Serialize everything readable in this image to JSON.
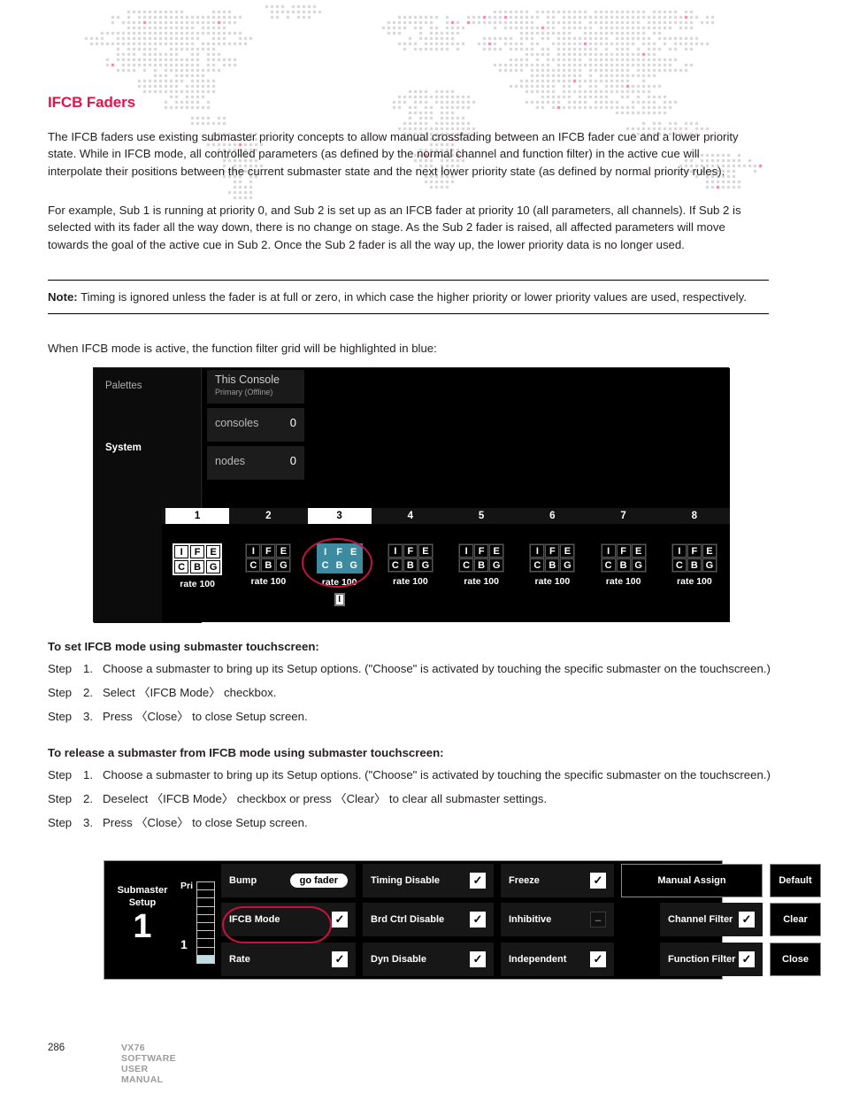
{
  "section": {
    "title": "IFCB Faders",
    "title_color": "#e2144a",
    "paragraphs": [
      "The IFCB faders use existing submaster priority concepts to allow manual crossfading between an IFCB fader cue and a lower priority state. While in IFCB mode, all controlled parameters (as defined by the normal channel and function filter) in the active cue will interpolate their positions between the current submaster state and the next lower priority state (as defined by normal priority rules).",
      "For example, Sub 1 is running at priority 0, and Sub 2 is set up as an IFCB fader at priority 10 (all parameters, all channels). If Sub 2 is selected with its fader all the way down, there is no change on stage. As the Sub 2 fader is raised, all affected parameters will move towards the goal of the active cue in Sub 2. Once the Sub 2 fader is all the way up, the lower priority data is no longer used."
    ],
    "note_label": "Note:",
    "note_text": " Timing is ignored unless the fader is at full or zero, in which case the higher priority or lower priority values are used, respectively.",
    "caption": "When IFCB mode is active, the function filter grid will be highlighted in blue:"
  },
  "fader_shot": {
    "sidebar": {
      "palettes_label": "Palettes",
      "system_label": "System"
    },
    "tiles": {
      "console_name": "This Console",
      "console_state": "Primary (Offline)",
      "consoles_key": "consoles",
      "consoles_value": "0",
      "nodes_key": "nodes",
      "nodes_value": "0"
    },
    "highlight_color": "#3d8ba1",
    "annotation_color": "#c8103f",
    "ifcb_flag": "I",
    "columns": [
      {
        "number": "1",
        "selected": true,
        "style": "light",
        "cells": [
          "I",
          "F",
          "E",
          "C",
          "B",
          "G"
        ],
        "rate": "rate 100",
        "ifcb_flag": false
      },
      {
        "number": "2",
        "selected": false,
        "style": "dark",
        "cells": [
          "I",
          "F",
          "E",
          "C",
          "B",
          "G"
        ],
        "rate": "rate 100",
        "ifcb_flag": false
      },
      {
        "number": "3",
        "selected": true,
        "style": "active",
        "cells": [
          "I",
          "F",
          "E",
          "C",
          "B",
          "G"
        ],
        "rate": "rate 100",
        "ifcb_flag": true
      },
      {
        "number": "4",
        "selected": false,
        "style": "dark",
        "cells": [
          "I",
          "F",
          "E",
          "C",
          "B",
          "G"
        ],
        "rate": "rate 100",
        "ifcb_flag": false
      },
      {
        "number": "5",
        "selected": false,
        "style": "dark",
        "cells": [
          "I",
          "F",
          "E",
          "C",
          "B",
          "G"
        ],
        "rate": "rate 100",
        "ifcb_flag": false
      },
      {
        "number": "6",
        "selected": false,
        "style": "dark",
        "cells": [
          "I",
          "F",
          "E",
          "C",
          "B",
          "G"
        ],
        "rate": "rate 100",
        "ifcb_flag": false
      },
      {
        "number": "7",
        "selected": false,
        "style": "dark",
        "cells": [
          "I",
          "F",
          "E",
          "C",
          "B",
          "G"
        ],
        "rate": "rate 100",
        "ifcb_flag": false
      },
      {
        "number": "8",
        "selected": false,
        "style": "dark",
        "cells": [
          "I",
          "F",
          "E",
          "C",
          "B",
          "G"
        ],
        "rate": "rate 100",
        "ifcb_flag": false
      }
    ]
  },
  "procedures": [
    {
      "heading": "To set IFCB mode using submaster touchscreen:",
      "steps": [
        {
          "word": "Step",
          "num": "1.",
          "text": "Choose a submaster to bring up its Setup options. (\"Choose\" is activated by touching the specific submaster on the touchscreen.)"
        },
        {
          "word": "Step",
          "num": "2.",
          "text": "Select 〈IFCB Mode〉 checkbox."
        },
        {
          "word": "Step",
          "num": "3.",
          "text": "Press 〈Close〉 to close Setup screen."
        }
      ]
    },
    {
      "heading": "To release a submaster from IFCB mode using submaster touchscreen:",
      "steps": [
        {
          "word": "Step",
          "num": "1.",
          "text": "Choose a submaster to bring up its Setup options. (\"Choose\" is activated by touching the specific submaster on the touchscreen.)"
        },
        {
          "word": "Step",
          "num": "2.",
          "text": "Deselect 〈IFCB Mode〉 checkbox or press 〈Clear〉 to clear all submaster settings."
        },
        {
          "word": "Step",
          "num": "3.",
          "text": "Press 〈Close〉 to close Setup screen."
        }
      ]
    }
  ],
  "setup_shot": {
    "title_line1": "Submaster",
    "title_line2": "Setup",
    "submaster_number": "1",
    "pri_label": "Pri",
    "pri_value": "1",
    "annotation_color": "#c8103f",
    "buttons": {
      "bump": {
        "label": "Bump",
        "value": "go fader",
        "type": "pill"
      },
      "ifcb_mode": {
        "label": "IFCB Mode",
        "state": "checked",
        "type": "checkbox"
      },
      "rate": {
        "label": "Rate",
        "state": "checked",
        "type": "checkbox"
      },
      "timing_disable": {
        "label": "Timing Disable",
        "state": "checked",
        "type": "checkbox"
      },
      "brd_ctrl_disable": {
        "label": "Brd Ctrl Disable",
        "state": "checked",
        "type": "checkbox"
      },
      "dyn_disable": {
        "label": "Dyn Disable",
        "state": "checked",
        "type": "checkbox"
      },
      "freeze": {
        "label": "Freeze",
        "state": "checked",
        "type": "checkbox"
      },
      "inhibitive": {
        "label": "Inhibitive",
        "state": "dash",
        "type": "checkbox"
      },
      "independent": {
        "label": "Independent",
        "state": "checked",
        "type": "checkbox"
      },
      "manual_assign": {
        "label": "Manual Assign",
        "type": "outline"
      },
      "channel_filter": {
        "label": "Channel Filter",
        "state": "checked",
        "type": "checkbox"
      },
      "function_filter": {
        "label": "Function Filter",
        "state": "checked",
        "type": "checkbox"
      },
      "default": {
        "label": "Default",
        "type": "outline"
      },
      "clear": {
        "label": "Clear",
        "type": "outline"
      },
      "close": {
        "label": "Close",
        "type": "outline"
      }
    },
    "check_glyph": "✓",
    "dash_glyph": "–"
  },
  "footer": {
    "page_number": "286",
    "manual_title": "VX76 SOFTWARE USER MANUAL"
  }
}
